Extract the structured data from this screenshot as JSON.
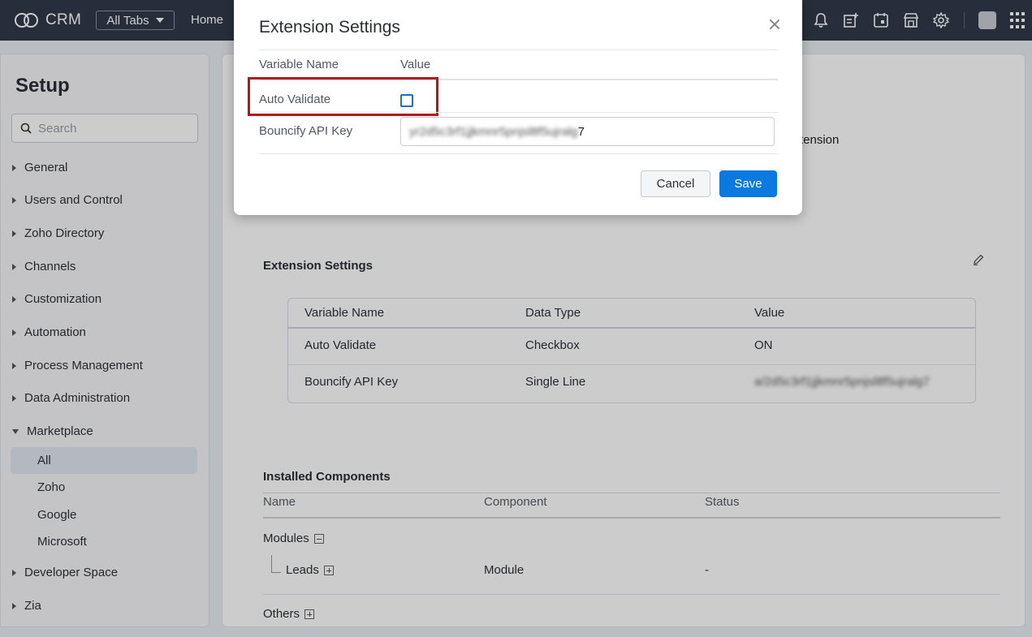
{
  "topbar": {
    "app_name": "CRM",
    "all_tabs_label": "All Tabs",
    "home_label": "Home",
    "icons": [
      "bell-icon",
      "add-note-icon",
      "calendar-icon",
      "marketplace-icon",
      "gear-icon",
      "avatar",
      "apps-grid-icon"
    ]
  },
  "sidebar": {
    "title": "Setup",
    "search_placeholder": "Search",
    "items": [
      {
        "label": "General"
      },
      {
        "label": "Users and Control"
      },
      {
        "label": "Zoho Directory"
      },
      {
        "label": "Channels"
      },
      {
        "label": "Customization"
      },
      {
        "label": "Automation"
      },
      {
        "label": "Process Management"
      },
      {
        "label": "Data Administration"
      },
      {
        "label": "Marketplace",
        "expanded": true
      },
      {
        "label": "Developer Space"
      },
      {
        "label": "Zia"
      }
    ],
    "marketplace_sub": [
      {
        "label": "All",
        "active": true
      },
      {
        "label": "Zoho"
      },
      {
        "label": "Google"
      },
      {
        "label": "Microsoft"
      }
    ]
  },
  "main": {
    "behind_text": "tension",
    "extension_settings": {
      "title": "Extension Settings",
      "headers": [
        "Variable Name",
        "Data Type",
        "Value"
      ],
      "rows": [
        {
          "name": "Auto Validate",
          "type": "Checkbox",
          "value": "ON"
        },
        {
          "name": "Bouncify API Key",
          "type": "Single Line",
          "value": "a/2d5c3rf1jjkmnr5pnjsl8f5ujralg7"
        }
      ]
    },
    "installed_components": {
      "title": "Installed Components",
      "headers": [
        "Name",
        "Component",
        "Status"
      ],
      "modules_label": "Modules",
      "leads_label": "Leads",
      "leads_component": "Module",
      "leads_status": "-",
      "others_label": "Others"
    }
  },
  "modal": {
    "title": "Extension Settings",
    "col_variable": "Variable Name",
    "col_value": "Value",
    "auto_validate_label": "Auto Validate",
    "auto_validate_checked": false,
    "api_key_label": "Bouncify API Key",
    "api_key_value_blurred": "yr2d5c3rf1jjkmnr5pnjsl8f5ujralg",
    "api_key_value_visible": "7",
    "cancel_label": "Cancel",
    "save_label": "Save"
  },
  "colors": {
    "topbar": "#313949",
    "primary_button": "#0a7ae0",
    "highlight_border": "#b5161b"
  }
}
